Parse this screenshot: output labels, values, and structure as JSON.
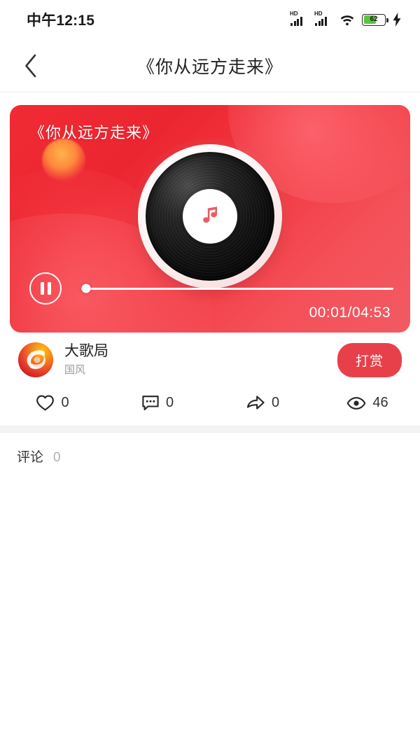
{
  "status_bar": {
    "time": "中午12:15",
    "signal_label": "HD",
    "battery_percent": "62",
    "battery_level": 62,
    "icons": [
      "signal-hd-icon",
      "signal-hd-icon",
      "wifi-icon",
      "battery-icon",
      "charging-bolt-icon"
    ]
  },
  "nav": {
    "back_icon": "chevron-left-icon",
    "title": "《你从远方走来》"
  },
  "player": {
    "title": "《你从远方走来》",
    "disc_icon": "music-note-icon",
    "play_state_icon": "pause-icon",
    "time_display": "00:01/04:53",
    "elapsed": "00:01",
    "duration": "04:53",
    "progress_percent": 0.34,
    "accent_color": "#ec2630",
    "card_color_start": "#f02b34",
    "card_color_end": "#f25a62"
  },
  "author": {
    "avatar_icon": "phoenix-logo-avatar",
    "name": "大歌局",
    "tag": "国风",
    "reward_label": "打赏",
    "reward_color": "#e8404a"
  },
  "stats": [
    {
      "icon": "heart-icon",
      "name": "like",
      "count": "0"
    },
    {
      "icon": "comment-icon",
      "name": "comment",
      "count": "0"
    },
    {
      "icon": "share-icon",
      "name": "share",
      "count": "0"
    },
    {
      "icon": "eye-icon",
      "name": "views",
      "count": "46"
    }
  ],
  "comments": {
    "title": "评论",
    "count": "0"
  }
}
